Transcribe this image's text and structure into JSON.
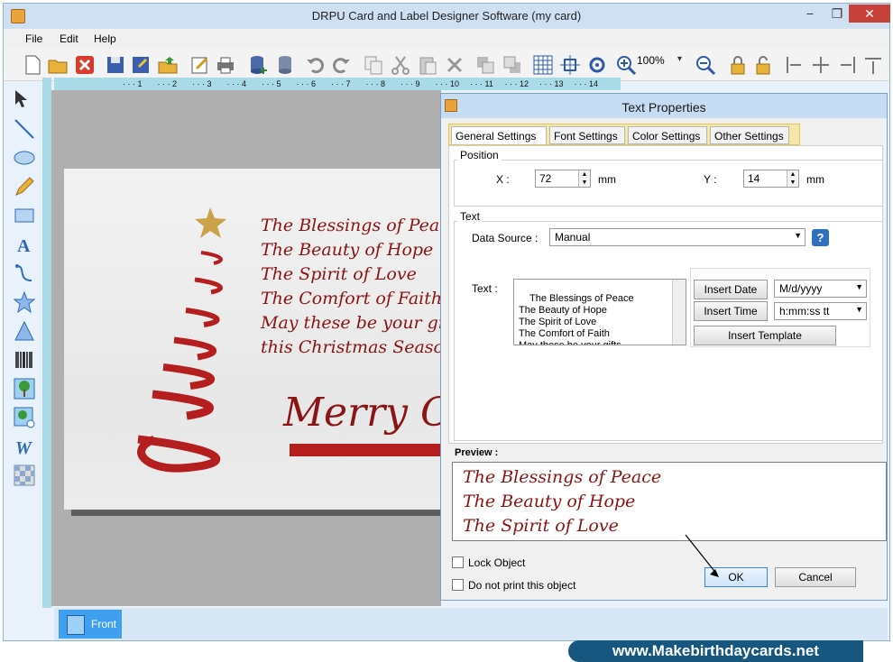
{
  "window": {
    "title": "DRPU Card and Label Designer Software  (my card)",
    "minimize_glyph": "−",
    "maximize_glyph": "❐",
    "close_glyph": "✕"
  },
  "menu": {
    "file": "File",
    "edit": "Edit",
    "help": "Help"
  },
  "toolbar": {
    "zoom_value": "100%"
  },
  "ruler": {
    "marks": [
      "1",
      "2",
      "3",
      "4",
      "5",
      "6",
      "7",
      "8",
      "9",
      "10",
      "11",
      "12",
      "13",
      "14"
    ]
  },
  "card": {
    "lines": [
      "The Blessings of Peace",
      "The Beauty of Hope",
      "The Spirit of Love",
      "The Comfort of Faith",
      "May these be your gifts",
      " this Christmas Season."
    ],
    "merry_text": "Merry C"
  },
  "pages": {
    "front_label": "Front"
  },
  "footer": {
    "link_text": "www.Makebirthdaycards.net"
  },
  "dialog": {
    "title": "Text Properties",
    "tabs": [
      "General Settings",
      "Font Settings",
      "Color Settings",
      "Other Settings"
    ],
    "position": {
      "label": "Position",
      "x_label": "X :",
      "x_value": "72",
      "y_label": "Y :",
      "y_value": "14",
      "unit": "mm"
    },
    "text_group": {
      "label": "Text",
      "data_source_label": "Data Source :",
      "data_source_value": "Manual",
      "text_label": "Text :",
      "text_value": "The Blessings of Peace\nThe Beauty of Hope\nThe Spirit of Love\nThe Comfort of Faith\nMay these be your gifts",
      "insert_date_label": "Insert Date",
      "date_format": "M/d/yyyy",
      "insert_time_label": "Insert Time",
      "time_format": "h:mm:ss tt",
      "insert_template_label": "Insert Template"
    },
    "preview": {
      "label": "Preview :",
      "lines": [
        "The Blessings of Peace",
        "The Beauty of Hope",
        "The Spirit of Love"
      ]
    },
    "lock_object_label": "Lock Object",
    "no_print_label": "Do not print this object",
    "ok_label": "OK",
    "cancel_label": "Cancel"
  },
  "colors": {
    "accent": "#3fa0f0",
    "card_text": "#8b1414",
    "footer_bg": "#17567f"
  }
}
